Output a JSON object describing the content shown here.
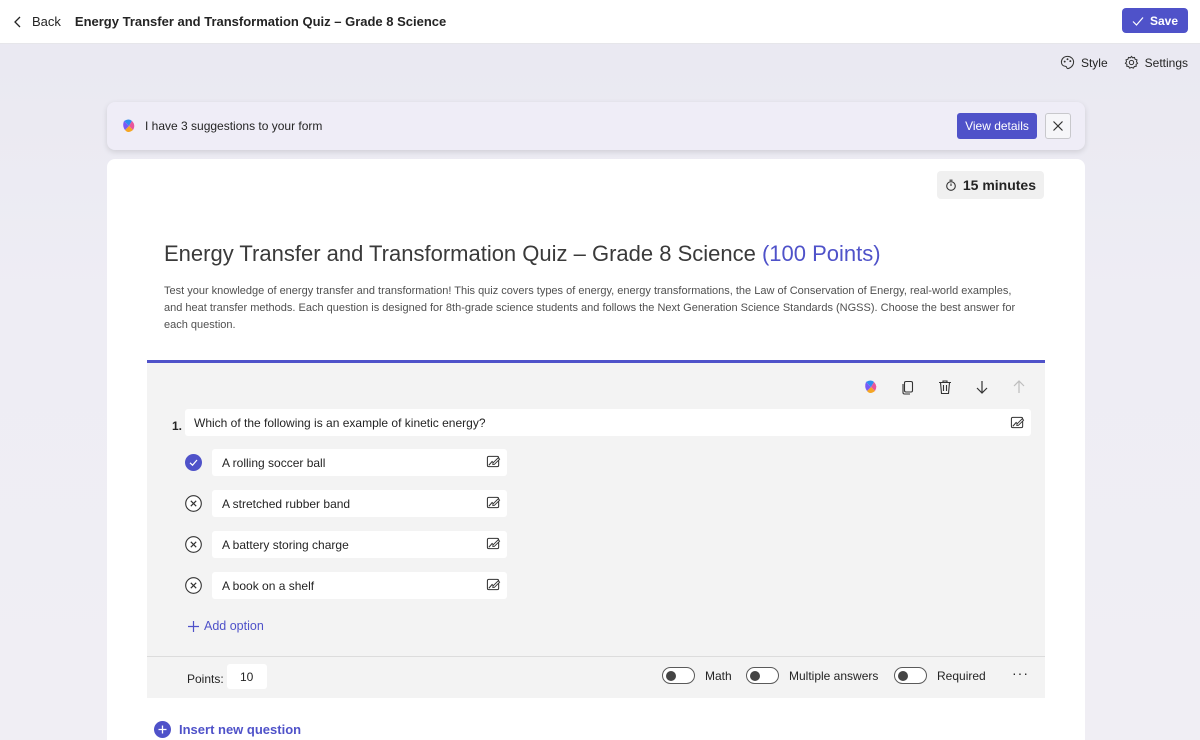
{
  "header": {
    "back_label": "Back",
    "title": "Energy Transfer and Transformation Quiz – Grade 8 Science",
    "save_label": "Save"
  },
  "toolbar": {
    "style_label": "Style",
    "settings_label": "Settings"
  },
  "suggestion": {
    "text": "I have 3 suggestions to your form",
    "view_label": "View details"
  },
  "quiz": {
    "timer": "15 minutes",
    "title": "Energy Transfer and Transformation Quiz – Grade 8 Science",
    "points_text": "(100 Points)",
    "description": "Test your knowledge of energy transfer and transformation! This quiz covers types of energy, energy transformations, the Law of Conservation of Energy, real-world examples, and heat transfer methods. Each question is designed for 8th-grade science students and follows the Next Generation Science Standards (NGSS). Choose the best answer for each question."
  },
  "question": {
    "number": "1.",
    "text": "Which of the following is an example of kinetic energy?",
    "options": [
      {
        "label": "A rolling soccer ball",
        "correct": true
      },
      {
        "label": "A stretched rubber band",
        "correct": false
      },
      {
        "label": "A battery storing charge",
        "correct": false
      },
      {
        "label": "A book on a shelf",
        "correct": false
      }
    ],
    "add_option_label": "Add option",
    "points_label": "Points:",
    "points_value": "10",
    "toggles": {
      "math": "Math",
      "multiple": "Multiple answers",
      "required": "Required"
    },
    "more": "···"
  },
  "insert_label": "Insert new question",
  "colors": {
    "accent": "#4f52c9"
  }
}
